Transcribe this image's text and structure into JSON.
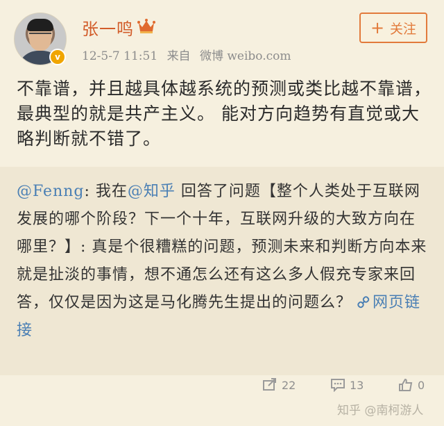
{
  "user": {
    "name": "张一鸣",
    "time": "12-5-7 11:51",
    "source_prefix": "来自",
    "source": "微博 weibo.com",
    "verified_mark": "v"
  },
  "actions": {
    "follow_label": "关注"
  },
  "post": {
    "text": "不靠谱，并且越具体越系统的预测或类比越不靠谱，最典型的就是共产主义。 能对方向趋势有直觉或大略判断就不错了。"
  },
  "repost": {
    "author": "@Fenng",
    "mention": "@知乎",
    "text_1": ": 我在",
    "text_2": " 回答了问题【整个人类处于互联网发展的哪个阶段？下一个十年，互联网升级的大致方向在哪里？】: 真是个很糟糕的问题，预测未来和判断方向本来就是扯淡的事情，想不通怎么还有这么多人假充专家来回答，仅仅是因为这是马化腾先生提出的问题么？ ",
    "link_label": "网页链接"
  },
  "stats": {
    "reposts": "22",
    "comments": "13",
    "likes": "0"
  },
  "watermark": "知乎 @南柯游人",
  "colors": {
    "name": "#d25c2a",
    "link": "#4a7fb4",
    "follow": "#e27a3b",
    "background": "#f6f0df"
  }
}
